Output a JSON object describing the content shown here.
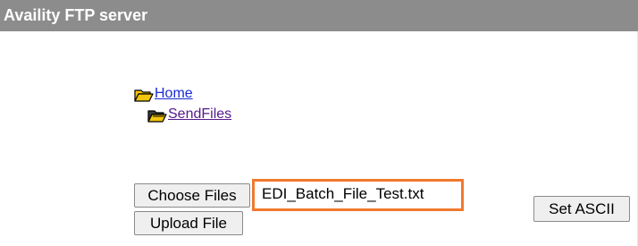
{
  "header": {
    "title": "Availity FTP server"
  },
  "tree": {
    "home_label": "Home",
    "home_icon": "folder-open-icon",
    "sendfiles_label": "SendFiles",
    "sendfiles_icon": "folder-open-filled-icon"
  },
  "upload": {
    "choose_label": "Choose Files",
    "selected_file": "EDI_Batch_File_Test.txt",
    "upload_label": "Upload File",
    "set_ascii_label": "Set ASCII"
  },
  "colors": {
    "header_bg": "#8c8c8c",
    "highlight": "#f07a2e",
    "link": "#1a2bd6",
    "visited_link": "#551a8b",
    "folder": "#f2c60d"
  }
}
